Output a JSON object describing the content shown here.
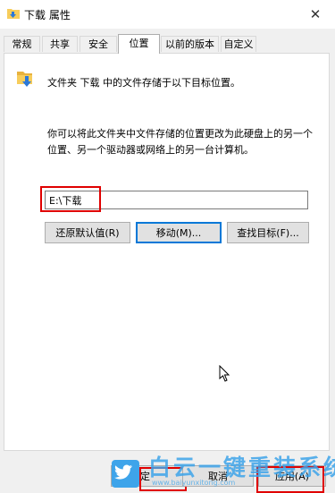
{
  "window": {
    "title": "下载 属性",
    "close_glyph": "✕"
  },
  "tabs": [
    {
      "label": "常规",
      "active": false
    },
    {
      "label": "共享",
      "active": false
    },
    {
      "label": "安全",
      "active": false
    },
    {
      "label": "位置",
      "active": true
    },
    {
      "label": "以前的版本",
      "active": false
    },
    {
      "label": "自定义",
      "active": false
    }
  ],
  "location": {
    "heading": "文件夹 下载 中的文件存储于以下目标位置。",
    "description": "你可以将此文件夹中文件存储的位置更改为此硬盘上的另一个位置、另一个驱动器或网络上的另一台计算机。",
    "path_value": "E:\\下载"
  },
  "buttons": {
    "restore_default": "还原默认值(R)",
    "move": "移动(M)...",
    "find_target": "查找目标(F)...",
    "ok": "定",
    "cancel": "取消",
    "apply": "应用(A)"
  },
  "watermark": {
    "text": "白云一键重装系统",
    "url": "www.baiyunxitong.com"
  },
  "icons": {
    "title": "folder-download-icon",
    "location": "folder-download-icon",
    "cursor": "mouse-cursor-icon",
    "watermark": "twitter-bird-icon"
  },
  "colors": {
    "highlight": "#e00000",
    "focus": "#0078d7",
    "watermark": "#3ea4ea",
    "folder": "#f7cd5b",
    "arrow": "#2b78d8"
  }
}
